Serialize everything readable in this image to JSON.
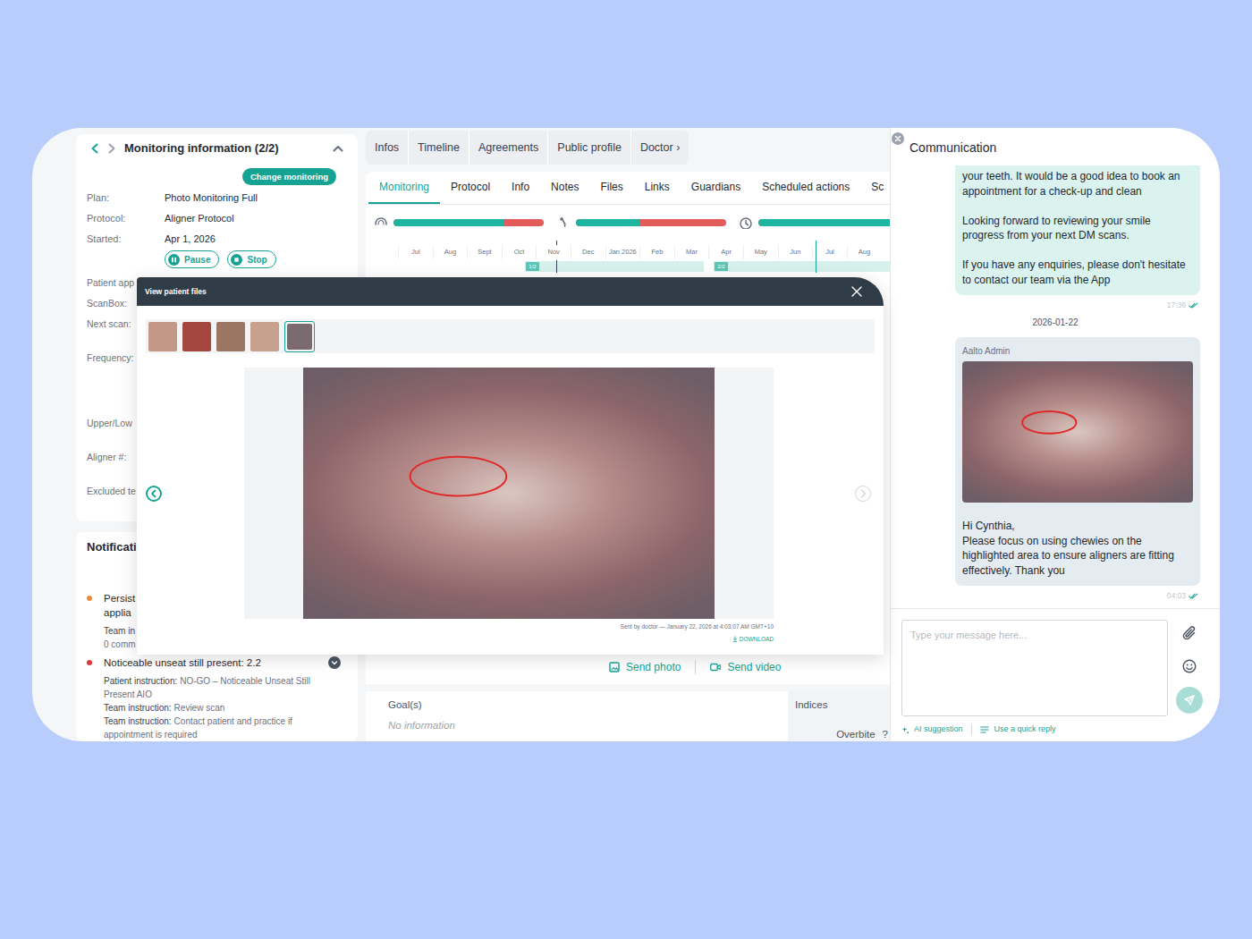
{
  "monitoring": {
    "title": "Monitoring information (2/2)",
    "change_button": "Change monitoring",
    "fields": [
      {
        "label": "Plan:",
        "value": "Photo Monitoring Full"
      },
      {
        "label": "Protocol:",
        "value": "Aligner Protocol"
      },
      {
        "label": "Started:",
        "value": "Apr 1, 2026"
      }
    ],
    "buttons": [
      {
        "label": "Pause",
        "kind": "pause"
      },
      {
        "label": "Stop",
        "kind": "stop"
      }
    ],
    "more_labels": [
      "Patient app",
      "ScanBox:",
      "Next scan:",
      "Frequency:",
      "Upper/Low",
      "Aligner #:",
      "Excluded te"
    ]
  },
  "notifications": {
    "title": "Notificati",
    "items": [
      {
        "color": "#f0883e",
        "title_lines": [
          "Persist",
          "applia"
        ],
        "details": [
          {
            "label": "Team in"
          }
        ],
        "footer": "0 comm"
      },
      {
        "color": "#e0393e",
        "title_lines": [
          "Noticeable unseat still present: 2.2"
        ],
        "details": [
          {
            "label": "Patient instruction:",
            "value": "NO-GO – Noticeable Unseat Still Present AIO"
          },
          {
            "label": "Team instruction:",
            "value": "Review scan"
          },
          {
            "label": "Team instruction:",
            "value": "Contact patient and practice if appointment is required"
          }
        ]
      }
    ]
  },
  "top_tabs": [
    "Infos",
    "Timeline",
    "Agreements",
    "Public profile",
    "Doctor ›"
  ],
  "sub_tabs": [
    {
      "label": "Monitoring",
      "selected": true
    },
    {
      "label": "Protocol",
      "selected": false
    },
    {
      "label": "Info",
      "selected": false
    },
    {
      "label": "Notes",
      "selected": false
    },
    {
      "label": "Files",
      "selected": false
    },
    {
      "label": "Links",
      "selected": false
    },
    {
      "label": "Guardians",
      "selected": false
    },
    {
      "label": "Scheduled actions",
      "selected": false
    },
    {
      "label": "Sc",
      "selected": false
    }
  ],
  "timeline": {
    "bars": [
      {
        "level": 0.73
      },
      {
        "level": 0.42
      },
      {
        "level": 1
      }
    ],
    "months": [
      "Jul",
      "Aug",
      "Sept",
      "Oct",
      "Nov",
      "Dec",
      "Jan 2026",
      "Feb",
      "Mar",
      "Apr",
      "May",
      "Jun",
      "Jul",
      "Aug"
    ],
    "phases": [
      "1/2",
      "2/2"
    ]
  },
  "media_actions": [
    "Send photo",
    "Send video"
  ],
  "goals": {
    "title": "Goal(s)",
    "value": "No information"
  },
  "indices": {
    "title": "Indices",
    "rows": [
      {
        "label": "Overbite",
        "value": "?"
      }
    ]
  },
  "viewer": {
    "title": "View patient files",
    "thumbnails": [
      {
        "selected": false
      },
      {
        "selected": false
      },
      {
        "selected": false
      },
      {
        "selected": false
      },
      {
        "selected": true
      }
    ],
    "caption": "Sent by doctor — January 22, 2026 at 4:03:07 AM GMT+10",
    "download": "DOWNLOAD"
  },
  "communication": {
    "title": "Communication",
    "messages": [
      {
        "kind": "text",
        "paragraphs": [
          "your teeth. It would be a good idea to book an appointment for a check-up and clean",
          "Looking forward to reviewing your smile progress from your next DM scans.",
          "If you have any enquiries, please don't hesitate to contact our team via the App"
        ],
        "time": "17:36",
        "read": true
      },
      {
        "kind": "date",
        "text": "2026-01-22"
      },
      {
        "kind": "photo",
        "author": "Aalto Admin",
        "paragraphs": [
          "Hi Cynthia,",
          "Please focus on using chewies on the highlighted area to ensure aligners are fitting effectively. Thank you"
        ],
        "time": "04:03",
        "read": true
      }
    ],
    "placeholder": "Type your message here...",
    "actions": [
      "AI suggestion",
      "Use a quick reply"
    ]
  }
}
